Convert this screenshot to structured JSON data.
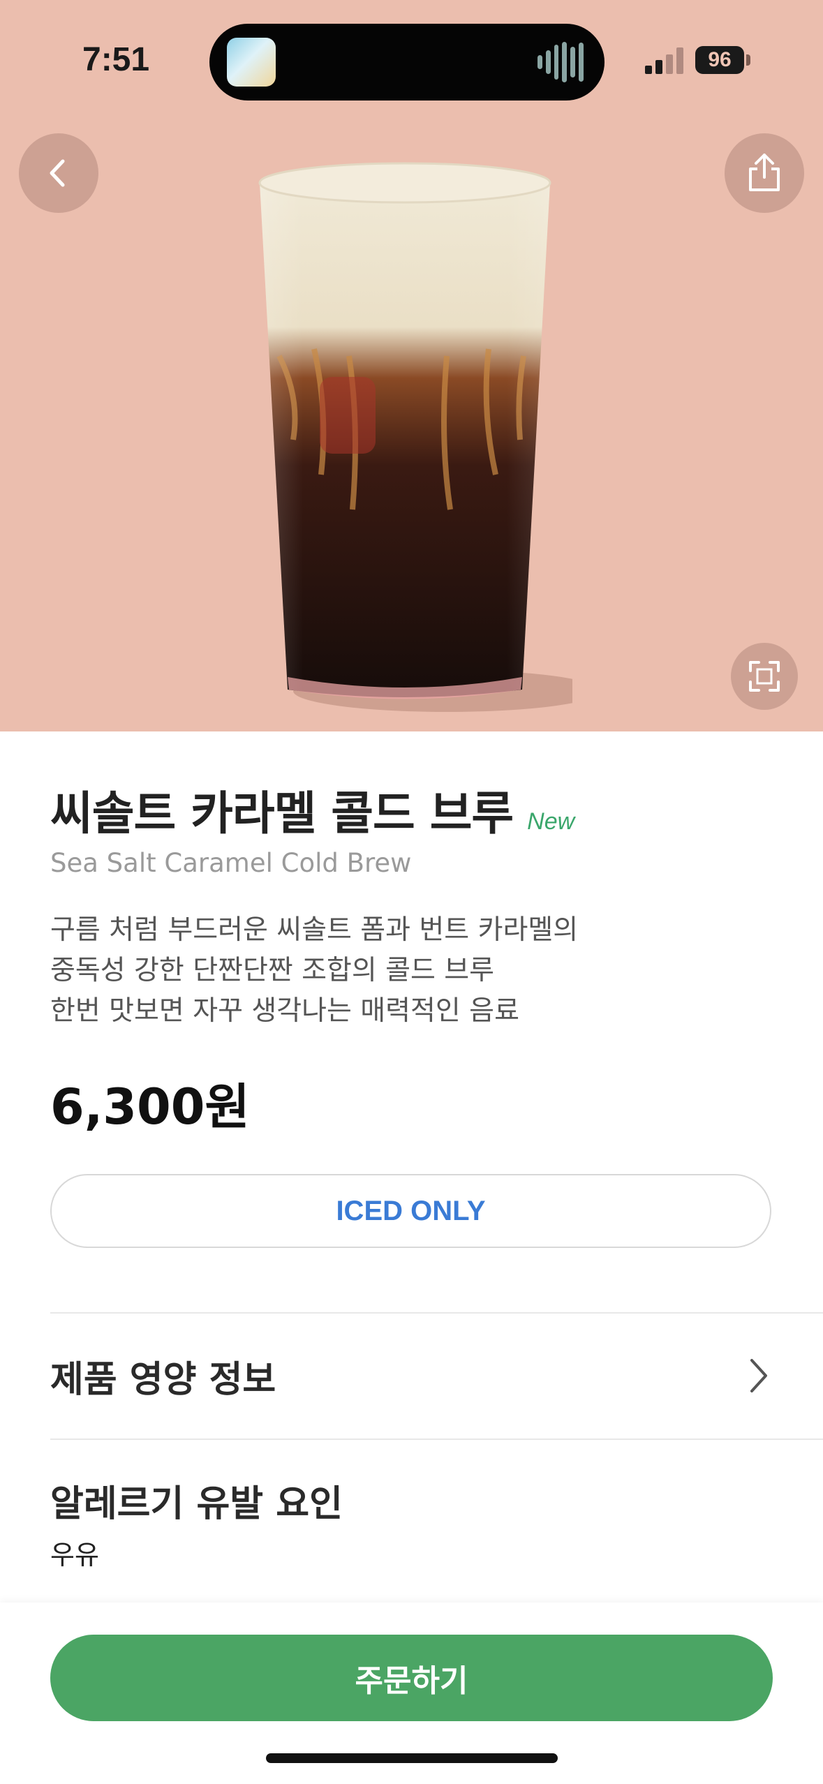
{
  "status_bar": {
    "time": "7:51",
    "battery": "96"
  },
  "product": {
    "name_ko": "씨솔트 카라멜 콜드 브루",
    "badge": "New",
    "name_en": "Sea Salt Caramel Cold Brew",
    "description": [
      "구름 처럼 부드러운 씨솔트 폼과 번트 카라멜의",
      "중독성 강한 단짠단짠 조합의 콜드 브루",
      "한번 맛보면 자꾸 생각나는 매력적인 음료"
    ],
    "price": "6,300원",
    "temperature_option": "ICED ONLY"
  },
  "sections": {
    "nutrition_label": "제품 영양 정보",
    "allergy_label": "알레르기 유발 요인",
    "allergy_value": "우유"
  },
  "actions": {
    "order_label": "주문하기"
  },
  "icons": {
    "back": "chevron-left-icon",
    "share": "share-icon",
    "expand": "fullscreen-icon",
    "nutrition_arrow": "chevron-right-icon"
  },
  "colors": {
    "hero_background": "#ebbeae",
    "accent_green": "#4ba564",
    "new_badge": "#3aa66b",
    "iced_text": "#3a7bd5"
  }
}
